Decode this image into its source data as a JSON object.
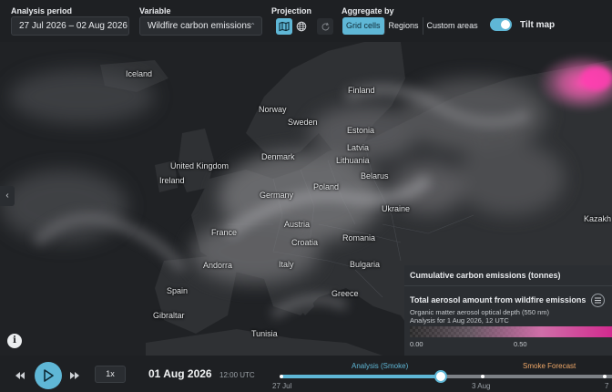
{
  "toolbar": {
    "analysis_period_label": "Analysis period",
    "analysis_period_value": "27 Jul 2026 – 02 Aug 2026",
    "variable_label": "Variable",
    "variable_value": "Wildfire carbon emissions",
    "projection_label": "Projection",
    "projection_options": [
      "map-icon",
      "globe-icon"
    ],
    "aggregate_label": "Aggregate by",
    "aggregate_options": [
      "Grid cells",
      "Regions",
      "Custom areas"
    ],
    "aggregate_selected": "Grid cells",
    "tilt_label": "Tilt map",
    "tilt_on": true
  },
  "map": {
    "countries": [
      "Iceland",
      "Finland",
      "Norway",
      "Sweden",
      "Estonia",
      "Latvia",
      "Lithuania",
      "Denmark",
      "United Kingdom",
      "Ireland",
      "Belarus",
      "Poland",
      "Germany",
      "Ukraine",
      "France",
      "Austria",
      "Croatia",
      "Romania",
      "Andorra",
      "Italy",
      "Bulgaria",
      "Spain",
      "Greece",
      "Gibraltar",
      "Tunisia",
      "Kazakh"
    ]
  },
  "legend": {
    "title": "Cumulative carbon emissions (tonnes)",
    "layer_title": "Total aerosol amount from wildfire emissions",
    "layer_desc": "Organic matter aerosol optical depth (550 nm)",
    "layer_analysis": "Analysis for 1 Aug 2026, 12 UTC",
    "ticks": [
      "0.00",
      "0.50"
    ],
    "gradient_colors": [
      "#ffffff00",
      "#cf6ea8",
      "#d22a8f"
    ]
  },
  "timeline": {
    "speed": "1x",
    "current_date": "01 Aug 2026",
    "current_time": "12:00 UTC",
    "analysis_label": "Analysis (Smoke)",
    "forecast_label": "Smoke Forecast",
    "tick_labels": [
      "27 Jul",
      "3 Aug",
      "7"
    ],
    "analysis_color": "#5fb7d6",
    "forecast_color": "#f0a868"
  }
}
